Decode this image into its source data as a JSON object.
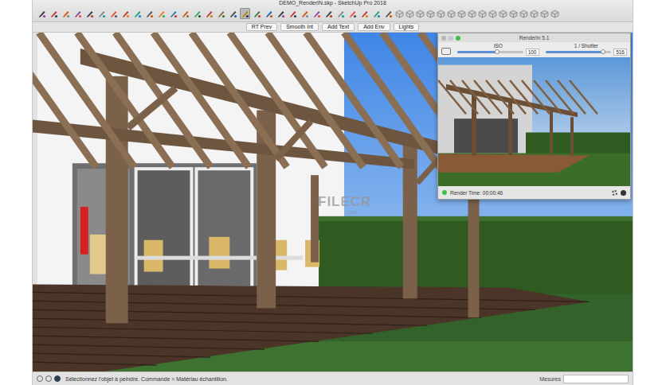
{
  "window": {
    "title": "DEMO_RenderIN.skp - SketchUp Pro 2018"
  },
  "toolbar": {
    "tools": [
      {
        "kind": "tool",
        "selected": false
      },
      {
        "kind": "tool",
        "selected": false
      },
      {
        "kind": "tool",
        "selected": false
      },
      {
        "kind": "tool",
        "selected": false
      },
      {
        "kind": "tool",
        "selected": false
      },
      {
        "kind": "tool",
        "selected": false
      },
      {
        "kind": "tool",
        "selected": false
      },
      {
        "kind": "tool",
        "selected": false
      },
      {
        "kind": "tool",
        "selected": false
      },
      {
        "kind": "tool",
        "selected": false
      },
      {
        "kind": "tool",
        "selected": false
      },
      {
        "kind": "tool",
        "selected": false
      },
      {
        "kind": "tool",
        "selected": false
      },
      {
        "kind": "tool",
        "selected": false
      },
      {
        "kind": "tool",
        "selected": false
      },
      {
        "kind": "tool",
        "selected": false
      },
      {
        "kind": "tool",
        "selected": false
      },
      {
        "kind": "tool",
        "selected": true
      },
      {
        "kind": "tool",
        "selected": false
      },
      {
        "kind": "tool",
        "selected": false
      },
      {
        "kind": "tool",
        "selected": false
      },
      {
        "kind": "tool",
        "selected": false
      },
      {
        "kind": "tool",
        "selected": false
      },
      {
        "kind": "tool",
        "selected": false
      },
      {
        "kind": "tool",
        "selected": false
      },
      {
        "kind": "tool",
        "selected": false
      },
      {
        "kind": "tool",
        "selected": false
      },
      {
        "kind": "tool",
        "selected": false
      },
      {
        "kind": "tool",
        "selected": false
      },
      {
        "kind": "tool",
        "selected": false
      },
      {
        "kind": "view",
        "selected": false
      },
      {
        "kind": "view",
        "selected": false
      },
      {
        "kind": "view",
        "selected": false
      },
      {
        "kind": "view",
        "selected": false
      },
      {
        "kind": "view",
        "selected": false
      },
      {
        "kind": "view",
        "selected": false
      },
      {
        "kind": "view",
        "selected": false
      },
      {
        "kind": "view",
        "selected": false
      },
      {
        "kind": "view",
        "selected": false
      },
      {
        "kind": "view",
        "selected": false
      },
      {
        "kind": "view",
        "selected": false
      },
      {
        "kind": "view",
        "selected": false
      },
      {
        "kind": "view",
        "selected": false
      },
      {
        "kind": "view",
        "selected": false
      },
      {
        "kind": "view",
        "selected": false
      },
      {
        "kind": "view",
        "selected": false
      }
    ]
  },
  "render_toolbar": {
    "buttons": [
      "RT Prev",
      "Smooth Int",
      "Add Text",
      "Add Env",
      "Lights"
    ]
  },
  "watermark": {
    "brand": "FILECR",
    "suffix": ".com"
  },
  "render_window": {
    "title": "RenderIn 5.1",
    "sliders": [
      {
        "label": "ISO",
        "value": "100",
        "level": 0.6
      },
      {
        "label": "1 / Shutter",
        "value": "516",
        "level": 0.88
      }
    ],
    "render_time": "Render Time: 00:00:46"
  },
  "status_bar": {
    "message": "Sélectionnez l'objet à peindre. Commande = Matériau échantillon.",
    "measure_label": "Mesures"
  }
}
